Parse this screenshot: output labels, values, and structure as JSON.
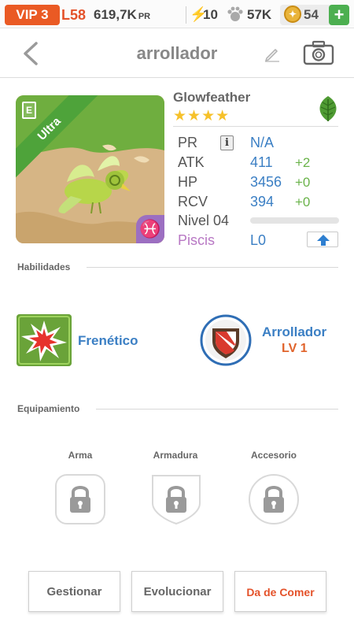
{
  "status_bar": {
    "vip": "VIP 3",
    "level": "L58",
    "power_value": "619,7K",
    "power_unit": "PR",
    "energy_value": "10",
    "food_value": "57K",
    "coins_value": "54",
    "add_label": "+"
  },
  "header": {
    "title": "arrollador"
  },
  "pet": {
    "name": "Glowfeather",
    "rarity": "Ultra",
    "stars": "★★★★",
    "element_icon": "leaf-icon",
    "card_badge": "E",
    "stats": [
      {
        "label": "PR",
        "value": "N/A",
        "increment": ""
      },
      {
        "label": "ATK",
        "value": "411",
        "increment": "+2"
      },
      {
        "label": "HP",
        "value": "3456",
        "increment": "+0"
      },
      {
        "label": "RCV",
        "value": "394",
        "increment": "+0"
      }
    ],
    "level_label": "Nivel 04",
    "level_progress": 0.0,
    "zodiac_label": "Piscis",
    "zodiac_value": "L0",
    "zodiac_symbol": "♓"
  },
  "abilities": {
    "section_title": "Habilidades",
    "skill_name": "Frenético",
    "trait_name": "Arrollador",
    "trait_level": "LV 1"
  },
  "equipment": {
    "section_title": "Equipamiento",
    "slots": [
      {
        "label": "Arma"
      },
      {
        "label": "Armadura"
      },
      {
        "label": "Accesorio"
      }
    ]
  },
  "actions": {
    "manage": "Gestionar",
    "evolve": "Evolucionar",
    "feed": "Da de Comer"
  },
  "colors": {
    "accent_orange": "#ea5a24",
    "stat_blue": "#3b7fc4",
    "increment_green": "#6ab34a",
    "rarity_green": "#4ea33a",
    "zodiac_purple": "#b878c4"
  }
}
